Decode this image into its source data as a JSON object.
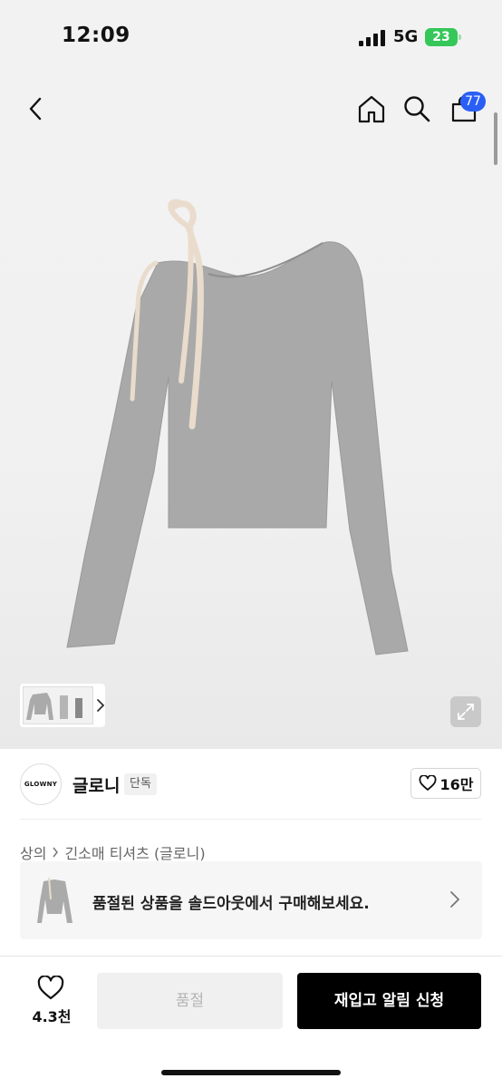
{
  "status_bar": {
    "time": "12:09",
    "network": "5G",
    "battery": "23"
  },
  "header": {
    "back_icon": "chevron-left-icon",
    "home_icon": "home-icon",
    "search_icon": "search-icon",
    "cart_icon": "shopping-bag-icon",
    "cart_count": "77"
  },
  "product": {
    "image_alt": "grey long-sleeve top with ivory ribbon tie",
    "thumbnail_strip_icon": "chevron-right-icon",
    "expand_icon": "expand-icon"
  },
  "brand": {
    "logo_text": "GLOWNY",
    "name": "글로니",
    "badge": "단독",
    "like_count": "16만"
  },
  "breadcrumb": {
    "items": [
      "상의",
      "긴소매 티셔츠 (글로니)"
    ]
  },
  "soldout_banner": {
    "text": "품절된 상품을 솔드아웃에서 구매해보세요."
  },
  "bottom_bar": {
    "wish_count": "4.3천",
    "soldout_label": "품절",
    "restock_label": "재입고 알림 신청"
  },
  "colors": {
    "accent_badge": "#2a5ff5",
    "battery": "#35c759",
    "primary_button": "#000000",
    "disabled_button": "#f0f0f0"
  }
}
